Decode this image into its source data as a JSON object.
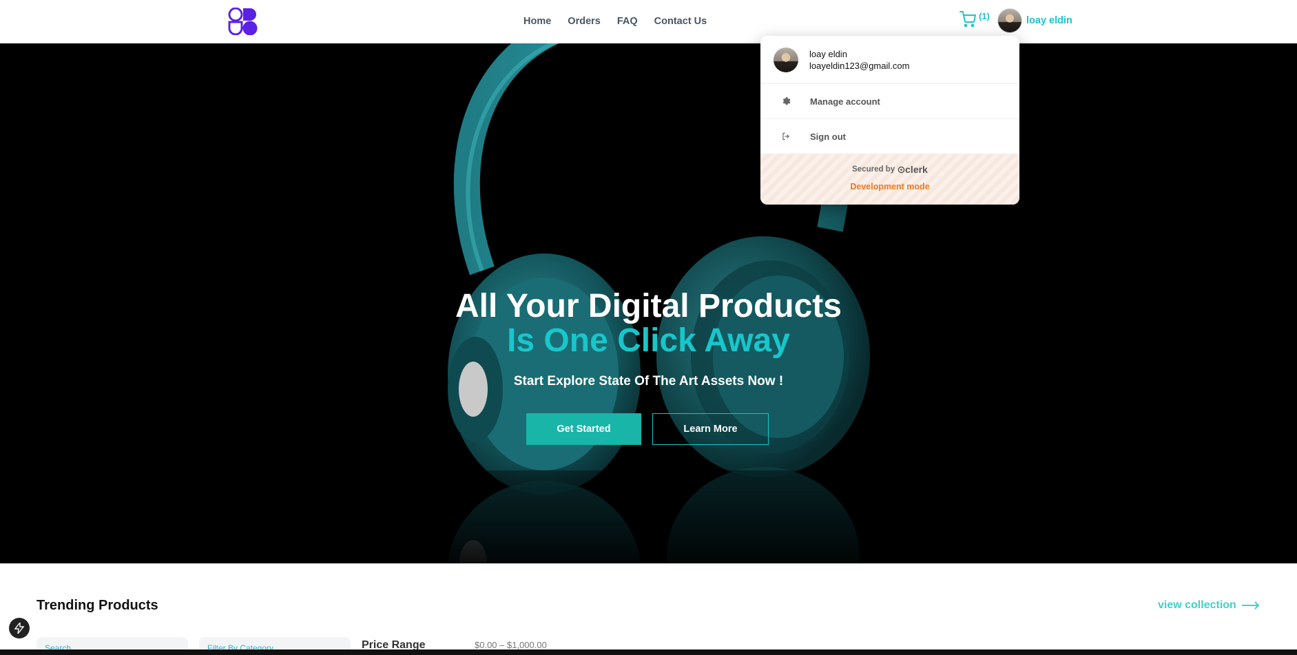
{
  "header": {
    "logo": "logo-icon",
    "nav": [
      "Home",
      "Orders",
      "FAQ",
      "Contact Us"
    ],
    "cart_count": "(1)",
    "user_name": "loay eldin"
  },
  "hero": {
    "title_line1": "All Your Digital Products",
    "title_line2": "Is One Click Away",
    "subtitle": "Start Explore State Of The Art Assets Now !",
    "primary_button": "Get Started",
    "secondary_button": "Learn More"
  },
  "dropdown": {
    "name": "loay eldin",
    "email": "loayeldin123@gmail.com",
    "manage_account": "Manage account",
    "sign_out": "Sign out",
    "secured_by": "Secured by",
    "brand": "clerk",
    "dev_mode": "Development mode"
  },
  "products": {
    "heading": "Trending Products",
    "view_collection": "view collection",
    "search_placeholder": "Search",
    "filter_placeholder": "Filter By Category",
    "price_label": "Price Range",
    "price_range": "$0.00 – $1,000.00"
  },
  "colors": {
    "accent": "#18c6cb",
    "button_primary": "#18b5a8",
    "dev_mode": "#f07722",
    "logo": "#5b21e6"
  }
}
